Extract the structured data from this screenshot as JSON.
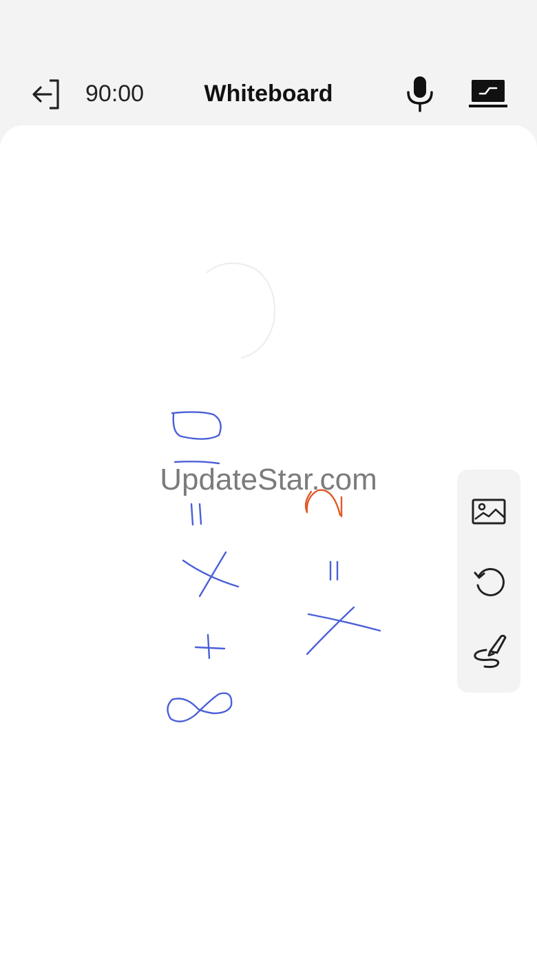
{
  "header": {
    "timer": "90:00",
    "title": "Whiteboard",
    "exit_icon": "exit-icon",
    "mic_icon": "microphone-icon",
    "screen_icon": "screen-share-icon"
  },
  "canvas": {
    "watermark": "UpdateStar.com",
    "ink_colors": {
      "blue": "#4a5fd8",
      "orange": "#e05a2a"
    }
  },
  "tools": [
    {
      "name": "image",
      "icon": "image-icon"
    },
    {
      "name": "undo",
      "icon": "undo-icon"
    },
    {
      "name": "pen",
      "icon": "pen-icon"
    }
  ]
}
